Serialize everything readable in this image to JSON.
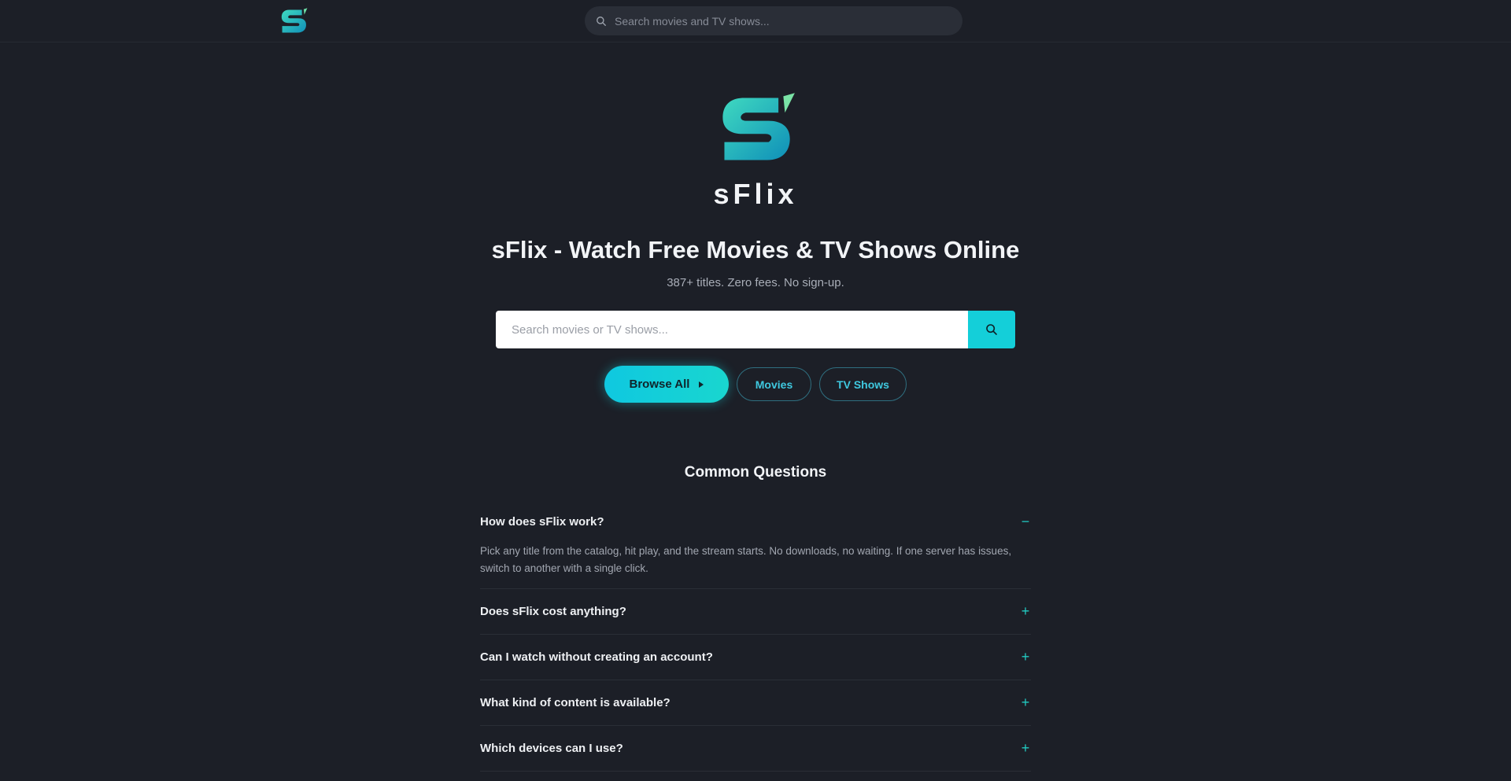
{
  "header": {
    "logo_icon": "sflix-logo-icon",
    "search_placeholder": "Search movies and TV shows..."
  },
  "hero": {
    "brand": "sFlix",
    "headline": "sFlix - Watch Free Movies & TV Shows Online",
    "subline": "387+ titles. Zero fees. No sign-up.",
    "search_placeholder": "Search movies or TV shows...",
    "search_icon": "search-icon"
  },
  "buttons": {
    "browse_all": "Browse All",
    "movies": "Movies",
    "tv_shows": "TV Shows"
  },
  "faq": {
    "title": "Common Questions",
    "items": [
      {
        "question": "How does sFlix work?",
        "answer": "Pick any title from the catalog, hit play, and the stream starts. No downloads, no waiting. If one server has issues, switch to another with a single click.",
        "expanded": true,
        "toggle": "−"
      },
      {
        "question": "Does sFlix cost anything?",
        "expanded": false,
        "toggle": "+"
      },
      {
        "question": "Can I watch without creating an account?",
        "expanded": false,
        "toggle": "+"
      },
      {
        "question": "What kind of content is available?",
        "expanded": false,
        "toggle": "+"
      },
      {
        "question": "Which devices can I use?",
        "expanded": false,
        "toggle": "+"
      }
    ]
  },
  "colors": {
    "background": "#1c1f27",
    "accent": "#14cfd9",
    "logo_gradient_start": "#2fd6c0",
    "logo_gradient_end": "#0f8fb8"
  }
}
